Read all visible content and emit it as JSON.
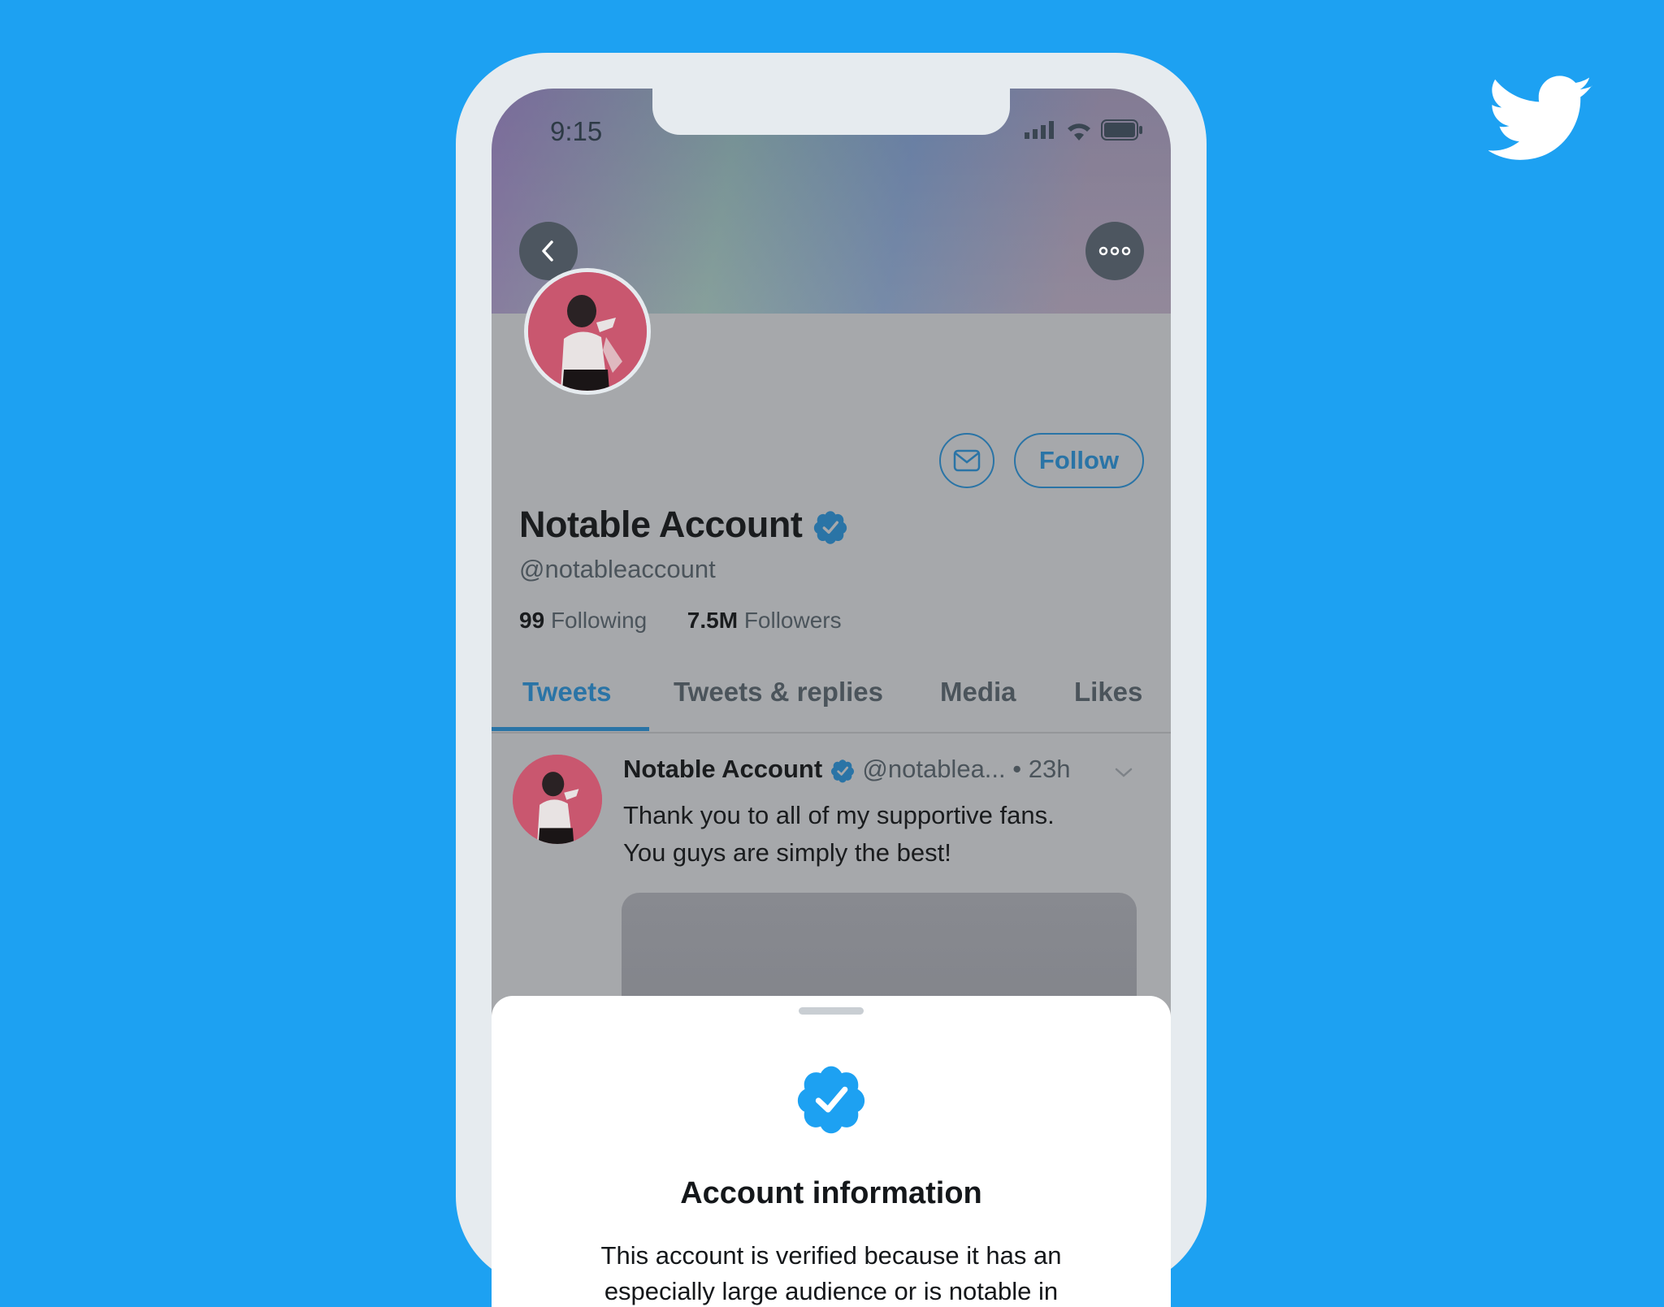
{
  "status_bar": {
    "time": "9:15"
  },
  "profile": {
    "display_name": "Notable Account",
    "handle": "@notableaccount",
    "following_count": "99",
    "following_label": "Following",
    "followers_count": "7.5M",
    "followers_label": "Followers",
    "follow_label": "Follow"
  },
  "tabs": [
    {
      "label": "Tweets"
    },
    {
      "label": "Tweets & replies"
    },
    {
      "label": "Media"
    },
    {
      "label": "Likes"
    }
  ],
  "tweet": {
    "author": "Notable Account",
    "handle": "@notablea...",
    "separator": "•",
    "time": "23h",
    "text_line1": "Thank you to all of my supportive fans.",
    "text_line2": "You guys are simply the best!"
  },
  "sheet": {
    "title": "Account information",
    "body": "This account is verified because it has an especially large audience or is notable in"
  },
  "colors": {
    "background": "#1DA1F2",
    "accent": "#2a74a6",
    "verified_badge": "#1DA1F2"
  },
  "icons": [
    "twitter-bird-icon",
    "back-arrow-icon",
    "more-icon",
    "mail-icon",
    "verified-badge-icon",
    "signal-icon",
    "wifi-icon",
    "battery-icon",
    "chevron-down-icon"
  ]
}
